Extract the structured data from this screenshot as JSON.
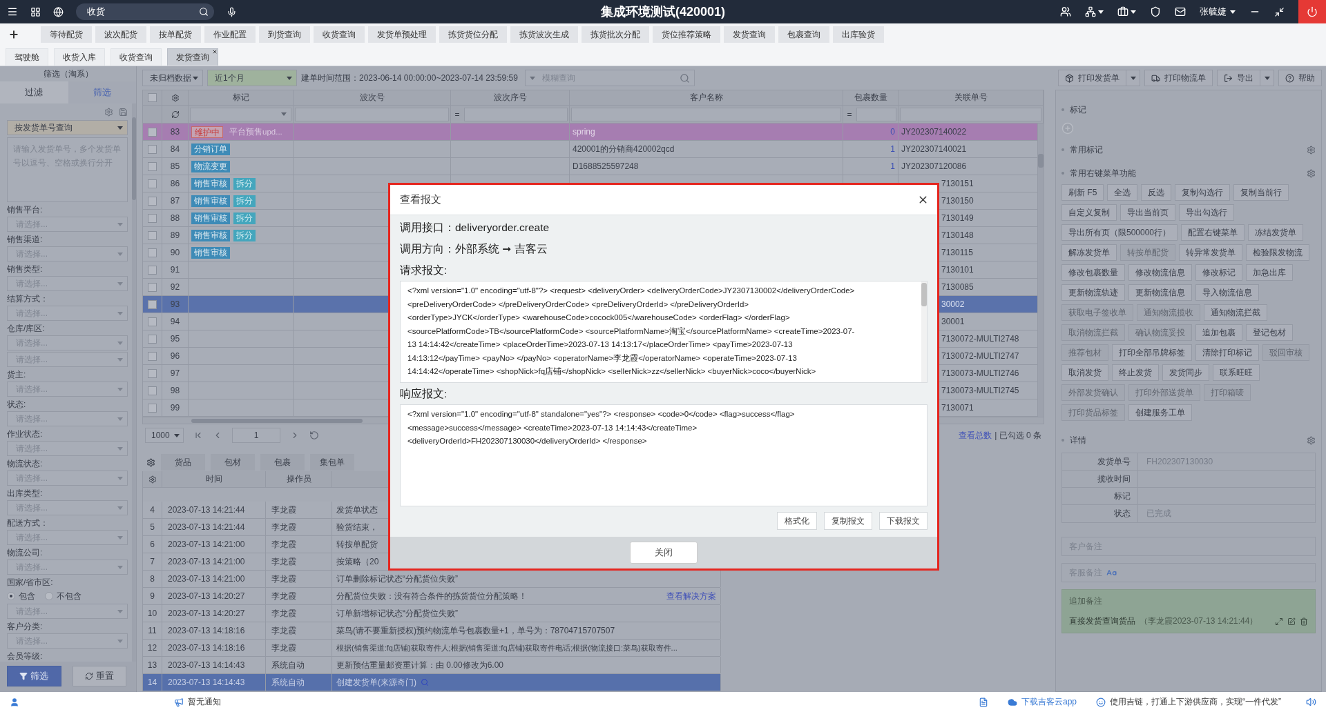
{
  "top_bar": {
    "search": {
      "value": "收货"
    },
    "title": "集成环境测试(420001)",
    "user": "张毓婕"
  },
  "menu_buttons": [
    "等待配货",
    "波次配货",
    "按单配货",
    "作业配置",
    "到货查询",
    "收货查询",
    "发货单预处理",
    "拣货货位分配",
    "拣货波次生成",
    "拣货批次分配",
    "货位推荐策略",
    "发货查询",
    "包裹查询",
    "出库验货"
  ],
  "page_tabs": [
    {
      "label": "驾驶舱",
      "selected": false
    },
    {
      "label": "收货入库",
      "selected": false
    },
    {
      "label": "收货查询",
      "selected": false
    },
    {
      "label": "发货查询",
      "selected": true
    }
  ],
  "sidebar": {
    "title": "筛选（淘系）",
    "tabs": [
      {
        "label": "过滤",
        "selected": false
      },
      {
        "label": "筛选",
        "selected": true
      }
    ],
    "query_mode": "按发货单号查询",
    "query_placeholder": "请输入发货单号，多个发货单号以逗号、空格或换行分开",
    "fields": [
      {
        "label": "销售平台:",
        "selects": [
          {
            "placeholder": "请选择..."
          }
        ]
      },
      {
        "label": "销售渠道:",
        "selects": [
          {
            "placeholder": "请选择..."
          }
        ]
      },
      {
        "label": "销售类型:",
        "selects": [
          {
            "placeholder": "请选择..."
          }
        ]
      },
      {
        "label": "结算方式：",
        "selects": [
          {
            "placeholder": "请选择..."
          }
        ]
      },
      {
        "label": "仓库/库区:",
        "selects": [
          {
            "placeholder": "请选择..."
          },
          {
            "placeholder": "请选择..."
          }
        ]
      },
      {
        "label": "货主:",
        "selects": [
          {
            "placeholder": "请选择..."
          }
        ]
      },
      {
        "label": "状态:",
        "selects": [
          {
            "placeholder": "请选择..."
          }
        ]
      },
      {
        "label": "作业状态:",
        "selects": [
          {
            "placeholder": "请选择..."
          }
        ]
      },
      {
        "label": "物流状态:",
        "selects": [
          {
            "placeholder": "请选择..."
          }
        ]
      },
      {
        "label": "出库类型:",
        "selects": [
          {
            "placeholder": "请选择..."
          }
        ]
      },
      {
        "label": "配送方式：",
        "selects": [
          {
            "placeholder": "请选择..."
          }
        ]
      },
      {
        "label": "物流公司:",
        "selects": [
          {
            "placeholder": "请选择..."
          }
        ]
      },
      {
        "label": "国家/省市区:",
        "options": [
          {
            "label": "包含",
            "selected": true
          },
          {
            "label": "不包含",
            "selected": false
          }
        ],
        "selects": [
          {
            "placeholder": "请选择..."
          }
        ]
      },
      {
        "label": "客户分类:",
        "selects": [
          {
            "placeholder": "请选择..."
          }
        ]
      },
      {
        "label": "会员等级:"
      }
    ],
    "filter_button": "筛选",
    "reset_button": "重置"
  },
  "toolbar": {
    "archive_select": "未归档数据",
    "range_select": "近1个月",
    "range_text": "建单时间范围：2023-06-14 00:00:00~2023-07-14 23:59:59",
    "search_placeholder": "模糊查询"
  },
  "table": {
    "all_checked": false,
    "columns": [
      "标记",
      "波次号",
      "波次序号",
      "客户名称",
      "包裹数量",
      "关联单号"
    ],
    "filter_row": [
      {
        "kind": "select"
      },
      {
        "kind": "input"
      },
      {
        "kind": "op_input",
        "op": "="
      },
      {
        "kind": "input"
      },
      {
        "kind": "op_input",
        "op": "="
      },
      {
        "kind": "input"
      }
    ],
    "rows": [
      {
        "no": "83",
        "checked": false,
        "highlighted": true,
        "selected": false,
        "marks": [
          {
            "kind": "warn",
            "text": "维护中"
          },
          {
            "kind": "note",
            "text": "平台预售upd..."
          }
        ],
        "customer": "spring",
        "count": "0",
        "ref": "JY202307140022"
      },
      {
        "no": "84",
        "checked": false,
        "highlighted": false,
        "selected": false,
        "marks": [
          {
            "kind": "tag",
            "text": "分销订单"
          }
        ],
        "customer": "420001的分销商420002qcd",
        "count": "1",
        "ref": "JY202307140021"
      },
      {
        "no": "85",
        "checked": false,
        "highlighted": false,
        "selected": false,
        "marks": [
          {
            "kind": "tag",
            "text": "物流变更"
          }
        ],
        "customer": "D1688525597248",
        "count": "1",
        "ref": "JY202307120086"
      },
      {
        "no": "86",
        "checked": false,
        "highlighted": false,
        "selected": false,
        "marks": [
          {
            "kind": "tag",
            "text": "销售审核"
          },
          {
            "kind": "split",
            "text": "拆分"
          }
        ],
        "ref_tail": "7130151"
      },
      {
        "no": "87",
        "checked": false,
        "highlighted": false,
        "selected": false,
        "marks": [
          {
            "kind": "tag",
            "text": "销售审核"
          },
          {
            "kind": "split",
            "text": "拆分"
          }
        ],
        "ref_tail": "7130150"
      },
      {
        "no": "88",
        "checked": false,
        "highlighted": false,
        "selected": false,
        "marks": [
          {
            "kind": "tag",
            "text": "销售审核"
          },
          {
            "kind": "split",
            "text": "拆分"
          }
        ],
        "ref_tail": "7130149"
      },
      {
        "no": "89",
        "checked": false,
        "highlighted": false,
        "selected": false,
        "marks": [
          {
            "kind": "tag",
            "text": "销售审核"
          },
          {
            "kind": "split",
            "text": "拆分"
          }
        ],
        "ref_tail": "7130148"
      },
      {
        "no": "90",
        "checked": false,
        "highlighted": false,
        "selected": false,
        "marks": [
          {
            "kind": "tag",
            "text": "销售审核"
          }
        ],
        "ref_tail": "7130115"
      },
      {
        "no": "91",
        "checked": false,
        "highlighted": false,
        "selected": false,
        "ref_tail": "7130101"
      },
      {
        "no": "92",
        "checked": false,
        "highlighted": false,
        "selected": false,
        "ref_tail": "7130085"
      },
      {
        "no": "93",
        "checked": false,
        "selected": true,
        "ref_tail": "30002"
      },
      {
        "no": "94",
        "checked": false,
        "highlighted": false,
        "selected": false,
        "ref_tail": "30001"
      },
      {
        "no": "95",
        "checked": false,
        "highlighted": false,
        "selected": false,
        "ref_tail": "7130072-MULTI2748"
      },
      {
        "no": "96",
        "checked": false,
        "highlighted": false,
        "selected": false,
        "ref_tail": "7130072-MULTI2747"
      },
      {
        "no": "97",
        "checked": false,
        "highlighted": false,
        "selected": false,
        "ref_tail": "7130073-MULTI2746"
      },
      {
        "no": "98",
        "checked": false,
        "highlighted": false,
        "selected": false,
        "ref_tail": "7130073-MULTI2745"
      },
      {
        "no": "99",
        "checked": false,
        "highlighted": false,
        "selected": false,
        "ref_tail": "7130071"
      }
    ]
  },
  "pager": {
    "page_size": "1000",
    "page": "1",
    "total_link": "查看总数",
    "checked_text": "| 已勾选 0 条"
  },
  "bottom_tabs": [
    "货品",
    "包材",
    "包裹",
    "集包单"
  ],
  "log": {
    "columns": [
      "时间",
      "操作员"
    ],
    "rows": [
      {
        "no": "4",
        "time": "2023-07-13 14:21:44",
        "operator": "李龙霞",
        "content": "发货单状态",
        "selected": false
      },
      {
        "no": "5",
        "time": "2023-07-13 14:21:44",
        "operator": "李龙霞",
        "content": "验货结束，",
        "selected": false
      },
      {
        "no": "6",
        "time": "2023-07-13 14:21:00",
        "operator": "李龙霞",
        "content": "转按单配货",
        "selected": false
      },
      {
        "no": "7",
        "time": "2023-07-13 14:21:00",
        "operator": "李龙霞",
        "content": "按策略（20",
        "selected": false
      },
      {
        "no": "8",
        "time": "2023-07-13 14:21:00",
        "operator": "李龙霞",
        "content": "订单删除标记状态“分配货位失败”",
        "selected": false
      },
      {
        "no": "9",
        "time": "2023-07-13 14:20:27",
        "operator": "李龙霞",
        "content": "分配货位失败：没有符合条件的拣货货位分配策略！",
        "link": "查看解决方案",
        "selected": false
      },
      {
        "no": "10",
        "time": "2023-07-13 14:20:27",
        "operator": "李龙霞",
        "content": "订单新增标记状态“分配货位失败”",
        "selected": false
      },
      {
        "no": "11",
        "time": "2023-07-13 14:18:16",
        "operator": "李龙霞",
        "content": "菜鸟(请不要重新授权)预约物流单号包裹数量+1，单号为：78704715707507",
        "selected": false
      },
      {
        "no": "12",
        "time": "2023-07-13 14:18:16",
        "operator": "李龙霞",
        "content": "根据(销售渠道:fq店铺)获取寄件人;根据(销售渠道:fq店铺)获取寄件电话;根据(物流接口:菜鸟)获取寄件...",
        "selected": false
      },
      {
        "no": "13",
        "time": "2023-07-13 14:14:43",
        "operator": "系统自动",
        "content": "更新预估重量邮资重计算：由 0.00修改为6.00",
        "selected": false
      },
      {
        "no": "14",
        "time": "2023-07-13 14:14:43",
        "operator": "系统自动",
        "content": "创建发货单(来源奇门)",
        "selected": true,
        "lookup": true
      }
    ]
  },
  "right_toolbar": [
    {
      "label": "打印发货单",
      "dropdown": true
    },
    {
      "label": "打印物流单",
      "dropdown": false
    },
    {
      "label": "导出",
      "dropdown": true
    },
    {
      "label": "帮助",
      "dropdown": false
    }
  ],
  "right_panel": {
    "marks_title": "标记",
    "common_marks_title": "常用标记",
    "menu_title": "常用右键菜单功能",
    "menu_rows": [
      [
        {
          "label": "刷新  F5",
          "disabled": false
        },
        {
          "label": "全选",
          "disabled": false
        },
        {
          "label": "反选",
          "disabled": false
        },
        {
          "label": "复制勾选行",
          "disabled": false
        },
        {
          "label": "复制当前行",
          "disabled": false
        }
      ],
      [
        {
          "label": "自定义复制",
          "disabled": false
        },
        {
          "label": "导出当前页",
          "disabled": false
        },
        {
          "label": "导出勾选行",
          "disabled": false
        }
      ],
      [
        {
          "label": "导出所有页（限500000行）",
          "disabled": false
        },
        {
          "label": "配置右键菜单",
          "disabled": false
        },
        {
          "label": "冻结发货单",
          "disabled": false
        }
      ],
      [
        {
          "label": "解冻发货单",
          "disabled": false
        },
        {
          "label": "转按单配货",
          "disabled": true
        },
        {
          "label": "转异常发货单",
          "disabled": false
        },
        {
          "label": "检验限发物流",
          "disabled": false
        }
      ],
      [
        {
          "label": "修改包裹数量",
          "disabled": false
        },
        {
          "label": "修改物流信息",
          "disabled": false
        },
        {
          "label": "修改标记",
          "disabled": false
        },
        {
          "label": "加急出库",
          "disabled": false
        }
      ],
      [
        {
          "label": "更新物流轨迹",
          "disabled": false
        },
        {
          "label": "更新物流信息",
          "disabled": false
        },
        {
          "label": "导入物流信息",
          "disabled": false
        }
      ],
      [
        {
          "label": "获取电子签收单",
          "disabled": true
        },
        {
          "label": "通知物流揽收",
          "disabled": true
        },
        {
          "label": "通知物流拦截",
          "disabled": false
        }
      ],
      [
        {
          "label": "取消物流拦截",
          "disabled": true
        },
        {
          "label": "确认物流妥投",
          "disabled": true
        },
        {
          "label": "追加包裹",
          "disabled": false
        },
        {
          "label": "登记包材",
          "disabled": false
        }
      ],
      [
        {
          "label": "推荐包材",
          "disabled": true
        },
        {
          "label": "打印全部吊牌标签",
          "disabled": false
        },
        {
          "label": "清除打印标记",
          "disabled": false
        },
        {
          "label": "驳回审核",
          "disabled": true
        }
      ],
      [
        {
          "label": "取消发货",
          "disabled": false
        },
        {
          "label": "终止发货",
          "disabled": false
        },
        {
          "label": "发货同步",
          "disabled": false
        },
        {
          "label": "联系旺旺",
          "disabled": false
        }
      ],
      [
        {
          "label": "外部发货确认",
          "disabled": true
        },
        {
          "label": "打印外部送货单",
          "disabled": true
        },
        {
          "label": "打印箱唛",
          "disabled": true
        }
      ],
      [
        {
          "label": "打印货品标签",
          "disabled": true
        },
        {
          "label": "创建服务工单",
          "disabled": false
        }
      ]
    ],
    "details_title": "详情",
    "details": [
      {
        "label": "发货单号",
        "value": "FH202307130030"
      },
      {
        "label": "揽收时间"
      },
      {
        "label": "标记"
      },
      {
        "label": "状态",
        "value": "已完成"
      }
    ],
    "customer_note": "客户备注",
    "service_note": "客服备注",
    "append_note": {
      "title": "追加备注",
      "text": "直接发货查询货品",
      "meta": "（李龙霞2023-07-13 14:21:44）"
    }
  },
  "status_bar": {
    "notice": "暂无通知",
    "download": "下载吉客云app",
    "promo": "使用吉链，打通上下游供应商，实现“一件代发”"
  },
  "dialog": {
    "title": "查看报文",
    "interface": "调用接口：deliveryorder.create",
    "direction": "调用方向：外部系统 ➞ 吉客云",
    "request_label": "请求报文:",
    "request_lines": [
      "<?xml version=\"1.0\" encoding=\"utf-8\"?> <request> <deliveryOrder> <deliveryOrderCode>JY2307130002</deliveryOrderCode>",
      "<preDeliveryOrderCode> </preDeliveryOrderCode> <preDeliveryOrderId> </preDeliveryOrderId>",
      "<orderType>JYCK</orderType> <warehouseCode>cocock005</warehouseCode> <orderFlag> </orderFlag>",
      "<sourcePlatformCode>TB</sourcePlatformCode> <sourcePlatformName>淘宝</sourcePlatformName> <createTime>2023-07-",
      "13 14:14:42</createTime> <placeOrderTime>2023-07-13 14:13:17</placeOrderTime> <payTime>2023-07-13",
      "14:13:12</payTime> <payNo> </payNo> <operatorName>李龙霞</operatorName> <operateTime>2023-07-13",
      "14:14:42</operateTime> <shopNick>fq店铺</shopNick> <sellerNick>zz</sellerNick> <buyerNick>coco</buyerNick>"
    ],
    "response_label": "响应报文:",
    "response_lines": [
      "<?xml version=\"1.0\" encoding=\"utf-8\" standalone=\"yes\"?> <response> <code>0</code> <flag>success</flag>",
      "<message>success</message> <createTime>2023-07-13 14:14:43</createTime>",
      "<deliveryOrderId>FH202307130030</deliveryOrderId> </response>"
    ],
    "buttons": [
      "格式化",
      "复制报文",
      "下载报文"
    ],
    "close": "关闭"
  }
}
